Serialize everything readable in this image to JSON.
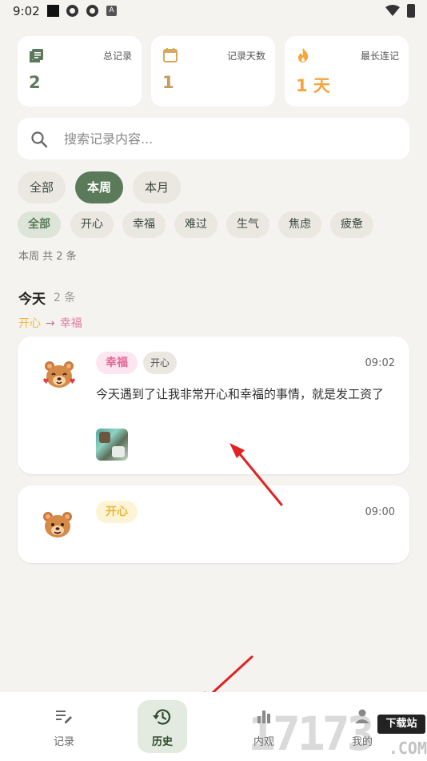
{
  "status_bar": {
    "time": "9:02",
    "icon_letter": "A"
  },
  "stats": [
    {
      "label": "总记录",
      "value": "2",
      "icon": "journal-icon"
    },
    {
      "label": "记录天数",
      "value": "1",
      "icon": "calendar-icon"
    },
    {
      "label": "最长连记",
      "value": "1 天",
      "icon": "flame-icon"
    }
  ],
  "search": {
    "placeholder": "搜索记录内容..."
  },
  "period_filters": [
    "全部",
    "本周",
    "本月"
  ],
  "period_selected": "本周",
  "mood_filters": [
    "全部",
    "开心",
    "幸福",
    "难过",
    "生气",
    "焦虑",
    "疲惫"
  ],
  "mood_selected": "全部",
  "summary": "本周 共 2 条",
  "day_group": {
    "title": "今天",
    "count": "2 条",
    "trend_from": "开心",
    "trend_arrow": "→",
    "trend_to": "幸福"
  },
  "entries": [
    {
      "mood_tag": "幸福",
      "secondary_tag": "开心",
      "time": "09:02",
      "text": "今天遇到了让我非常开心和幸福的事情，就是发工资了"
    },
    {
      "mood_tag": "开心",
      "time": "09:00"
    }
  ],
  "nav": [
    {
      "label": "记录",
      "icon": "edit-list-icon"
    },
    {
      "label": "历史",
      "icon": "history-icon"
    },
    {
      "label": "内观",
      "icon": "bar-chart-icon"
    },
    {
      "label": "我的",
      "icon": "profile-icon"
    }
  ],
  "nav_selected": "历史",
  "watermark": {
    "digits": "17173",
    "badge": "下载站",
    "domain": ".COM"
  },
  "colors": {
    "accent_green": "#5b7a5a",
    "happy_pink": "#e06a98",
    "joy_yellow": "#e8b83a",
    "streak_orange": "#f5a53b",
    "background": "#f5f3ef",
    "annotation_red": "#e02424"
  }
}
